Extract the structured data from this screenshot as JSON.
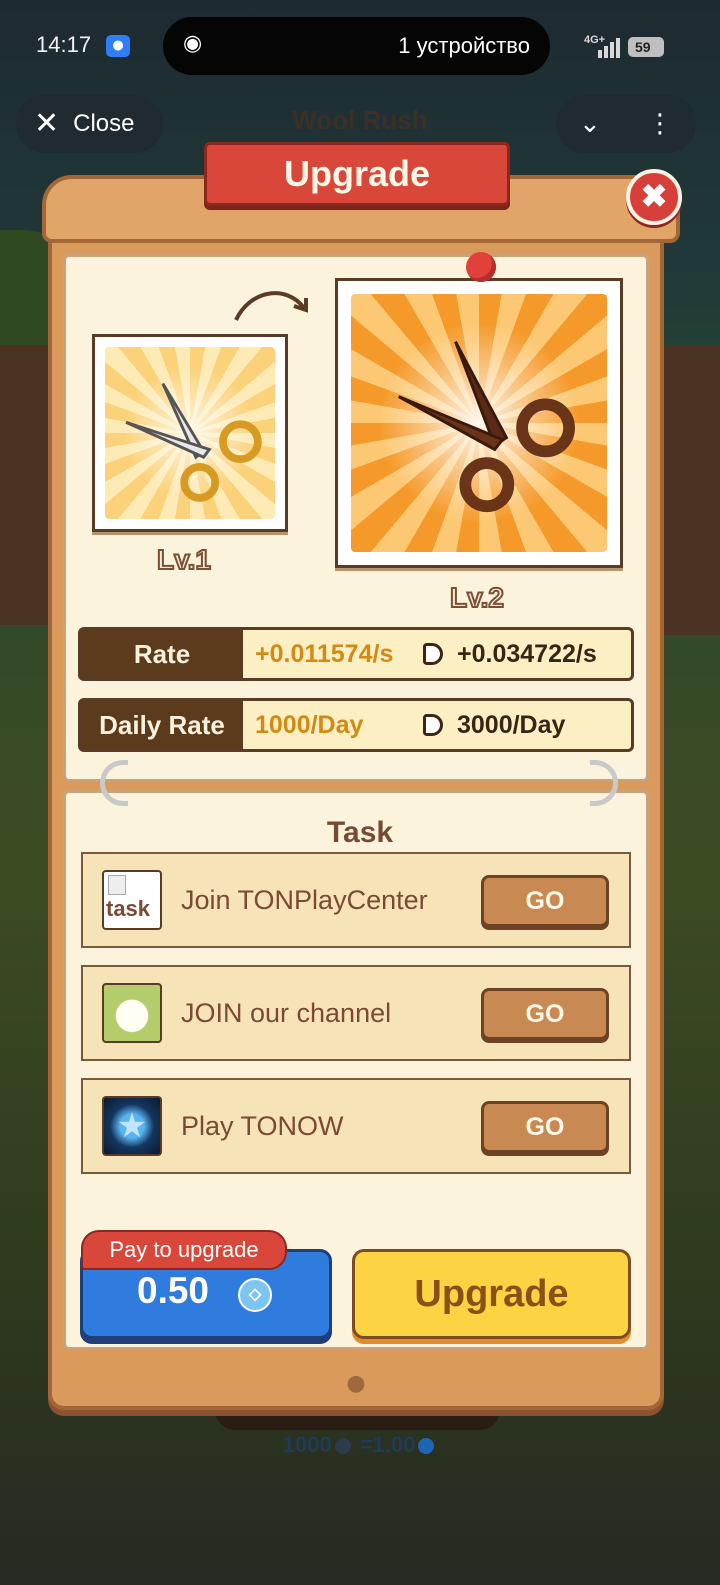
{
  "status_bar": {
    "time": "14:17",
    "island_text": "1 устройство",
    "network": "4G+",
    "battery": "59"
  },
  "header": {
    "close_label": "Close",
    "app_title": "Wool Rush"
  },
  "modal": {
    "title": "Upgrade",
    "current_level": "Lv.1",
    "next_level": "Lv.2",
    "stats": [
      {
        "label": "Rate",
        "current": "+0.011574/s",
        "next": "+0.034722/s"
      },
      {
        "label": "Daily Rate",
        "current": "1000/Day",
        "next": "3000/Day"
      }
    ],
    "task_title": "Task",
    "tasks": [
      {
        "label": "Join TONPlayCenter",
        "icon_alt": "task",
        "go": "GO"
      },
      {
        "label": "JOIN our channel",
        "icon": "sheep-icon",
        "go": "GO"
      },
      {
        "label": "Play TONOW",
        "icon": "star-icon",
        "go": "GO"
      }
    ],
    "pay_tag": "Pay to upgrade",
    "pay_amount": "0.50",
    "upgrade_button": "Upgrade"
  },
  "footer_rate": {
    "left": "1000",
    "right": "=1.00"
  },
  "colors": {
    "accent_red": "#d9473a",
    "upgrade_yellow": "#fcd342",
    "pay_blue": "#2f7bde",
    "panel_cream": "#fcf3dc"
  }
}
